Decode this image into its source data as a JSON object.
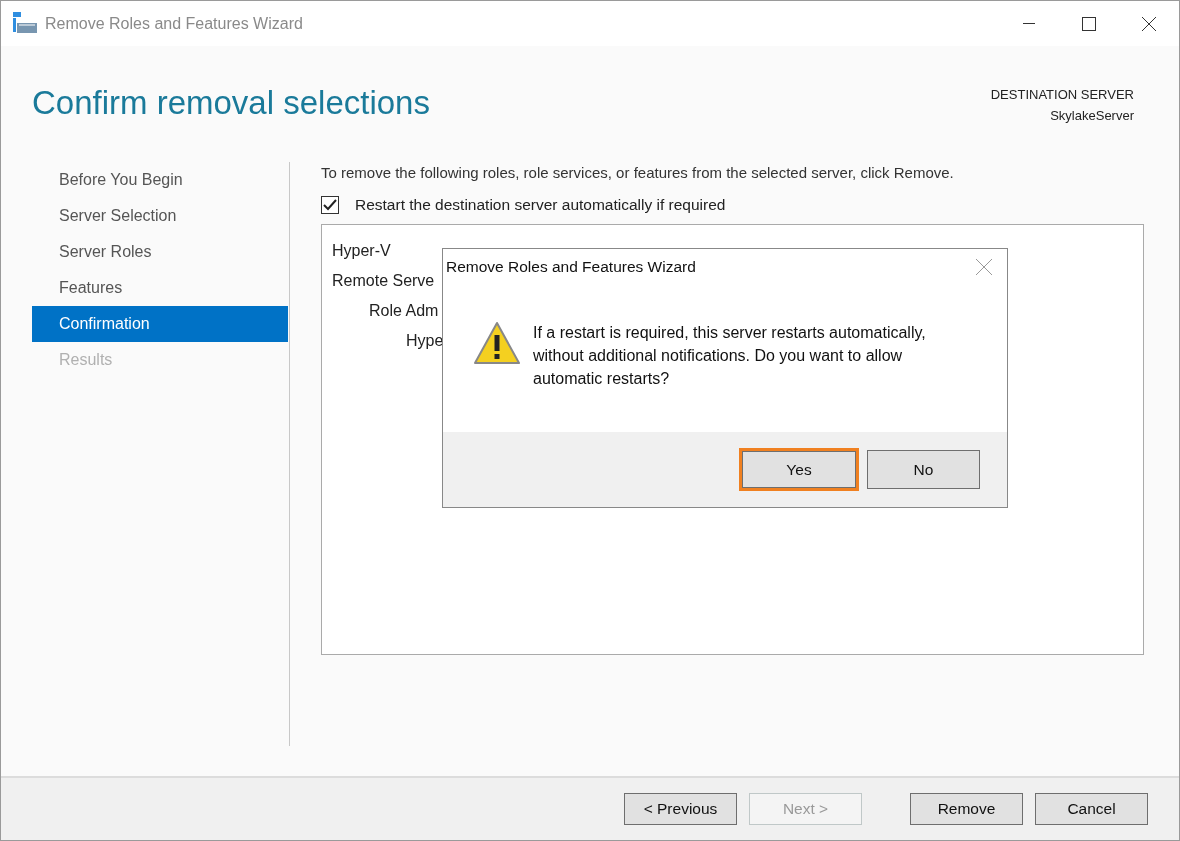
{
  "window": {
    "title": "Remove Roles and Features Wizard"
  },
  "header": {
    "title": "Confirm removal selections",
    "destination_label": "DESTINATION SERVER",
    "destination_server": "SkylakeServer"
  },
  "sidebar": {
    "items": [
      {
        "label": "Before You Begin",
        "selected": false,
        "disabled": false
      },
      {
        "label": "Server Selection",
        "selected": false,
        "disabled": false
      },
      {
        "label": "Server Roles",
        "selected": false,
        "disabled": false
      },
      {
        "label": "Features",
        "selected": false,
        "disabled": false
      },
      {
        "label": "Confirmation",
        "selected": true,
        "disabled": false
      },
      {
        "label": "Results",
        "selected": false,
        "disabled": true
      }
    ]
  },
  "content": {
    "instruction": "To remove the following roles, role services, or features from the selected server, click Remove.",
    "restart_checkbox": {
      "label": "Restart the destination server automatically if required",
      "checked": true
    },
    "tree": [
      {
        "label": "Hyper-V"
      },
      {
        "label": "Remote Serve",
        "children": [
          {
            "label": "Role Adm",
            "children": [
              {
                "label": "Hype"
              }
            ]
          }
        ]
      }
    ]
  },
  "dialog": {
    "title": "Remove Roles and Features Wizard",
    "message": "If a restart is required, this server restarts automatically, without additional notifications. Do you want to allow automatic restarts?",
    "buttons": [
      {
        "label": "Yes",
        "focused": true
      },
      {
        "label": "No",
        "focused": false
      }
    ]
  },
  "footer": {
    "buttons": [
      {
        "label": "< Previous",
        "disabled": false
      },
      {
        "label": "Next >",
        "disabled": true
      },
      {
        "label": "Remove",
        "disabled": false
      },
      {
        "label": "Cancel",
        "disabled": false
      }
    ]
  }
}
